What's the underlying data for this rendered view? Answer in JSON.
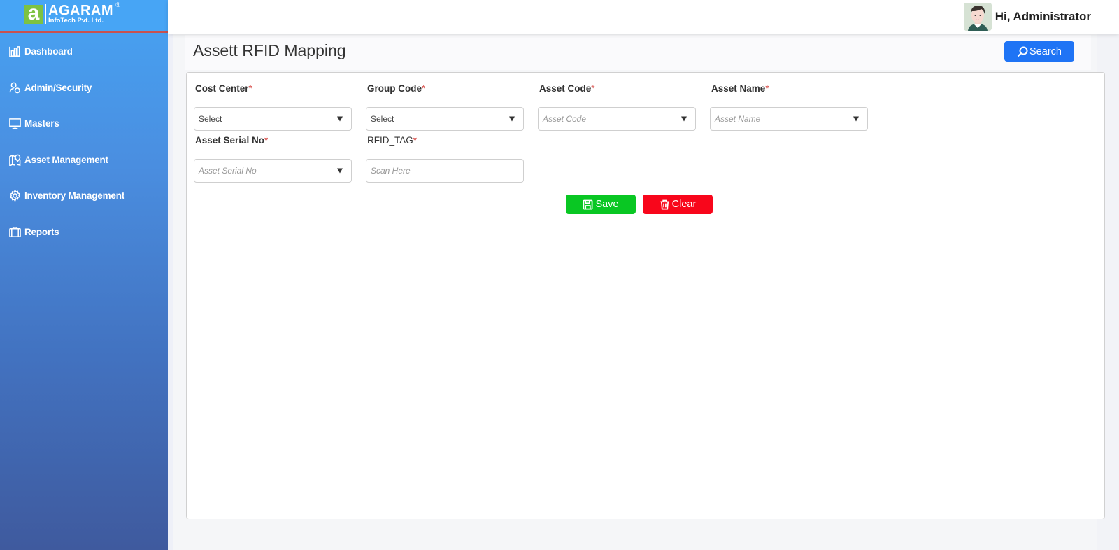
{
  "brand": {
    "logo_letter": "a",
    "name": "AGARAM",
    "subtitle": "InfoTech Pvt. Ltd.",
    "registered_mark": "®",
    "colors": {
      "sidebar_top": "#47a3f3",
      "sidebar_bottom": "#3f5a9e",
      "logo_green": "#7dc242",
      "header_rule": "#c9514f"
    }
  },
  "sidebar": {
    "items": [
      {
        "label": "Dashboard",
        "icon": "bar-chart-icon"
      },
      {
        "label": "Admin/Security",
        "icon": "user-shield-icon"
      },
      {
        "label": "Masters",
        "icon": "monitor-icon"
      },
      {
        "label": "Asset Management",
        "icon": "map-pin-icon"
      },
      {
        "label": "Inventory Management",
        "icon": "gear-icon"
      },
      {
        "label": "Reports",
        "icon": "briefcase-icon"
      }
    ]
  },
  "header": {
    "greeting": "Hi, Administrator",
    "avatar_icon": "user-avatar"
  },
  "page": {
    "title": "Assett RFID Mapping",
    "search_label": "Search",
    "search_color": "#1f74f5"
  },
  "form": {
    "required_mark": "*",
    "fields": [
      {
        "label": "Cost Center",
        "type": "select",
        "value": "Select",
        "placeholder": ""
      },
      {
        "label": "Group Code",
        "type": "select",
        "value": "Select",
        "placeholder": ""
      },
      {
        "label": "Asset Code",
        "type": "select",
        "value": "",
        "placeholder": "Asset Code"
      },
      {
        "label": "Asset Name",
        "type": "select",
        "value": "",
        "placeholder": "Asset Name"
      },
      {
        "label": "Asset Serial No",
        "type": "select",
        "value": "",
        "placeholder": "Asset Serial No"
      },
      {
        "label": "RFID_TAG",
        "type": "text",
        "value": "",
        "placeholder": "Scan Here"
      }
    ],
    "buttons": {
      "save_label": "Save",
      "save_color": "#09c723",
      "clear_label": "Clear",
      "clear_color": "#f8061b"
    }
  }
}
